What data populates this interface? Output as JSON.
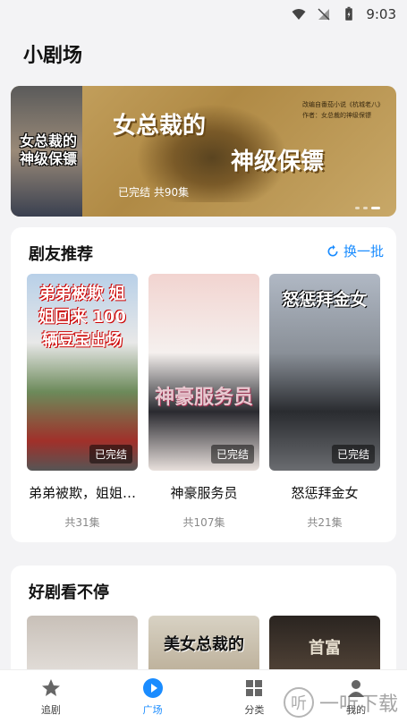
{
  "status_bar": {
    "time": "9:03"
  },
  "app": {
    "title": "小剧场"
  },
  "banner": {
    "poster_text": "女总裁的神级保镖",
    "headline_line1": "女总裁的",
    "headline_line2": "神级保镖",
    "source_line1": "改编自番茄小说《杭城老八》",
    "source_line2": "作者：女总裁的神级保镖",
    "status": "已完结 共90集"
  },
  "recommend": {
    "title": "剧友推荐",
    "refresh_label": "换一批",
    "items": [
      {
        "cover_text": "弟弟被欺 姐姐回来 100辆豆宝出场",
        "badge": "已完结",
        "name": "弟弟被欺，姐姐…",
        "episodes": "共31集"
      },
      {
        "cover_text": "神豪服务员",
        "badge": "已完结",
        "name": "神豪服务员",
        "episodes": "共107集"
      },
      {
        "cover_text": "怒惩拜金女",
        "badge": "已完结",
        "name": "怒惩拜金女",
        "episodes": "共21集"
      }
    ]
  },
  "hot": {
    "title": "好剧看不停",
    "items": [
      {
        "cover_text": ""
      },
      {
        "cover_text": "美女总裁的"
      },
      {
        "cover_text": "首富"
      }
    ]
  },
  "tabbar": {
    "items": [
      {
        "label": "追剧",
        "icon": "star-icon"
      },
      {
        "label": "广场",
        "icon": "play-icon"
      },
      {
        "label": "分类",
        "icon": "grid-icon"
      },
      {
        "label": "我的",
        "icon": "user-icon"
      }
    ],
    "active": "广场"
  },
  "watermark": {
    "text": "一听下载",
    "icon_char": "听"
  }
}
